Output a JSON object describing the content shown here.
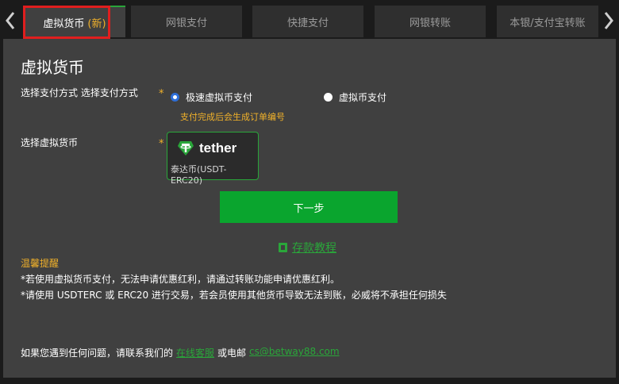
{
  "tabs": [
    {
      "label": "虚拟货币",
      "badge": "(新)",
      "active": true
    },
    {
      "label": "网银支付",
      "active": false
    },
    {
      "label": "快捷支付",
      "active": false
    },
    {
      "label": "网银转账",
      "active": false
    },
    {
      "label": "本银/支付宝转账",
      "active": false
    }
  ],
  "panel": {
    "title": "虚拟货币",
    "payment_method": {
      "label": "选择支付方式 选择支付方式",
      "required_mark": "*",
      "options": [
        {
          "label": "极速虚拟币支付",
          "selected": true
        },
        {
          "label": "虚拟币支付",
          "selected": false
        }
      ],
      "hint": "支付完成后会生成订单编号"
    },
    "currency": {
      "label": "选择虚拟货币",
      "required_mark": "*",
      "card": {
        "brand": "tether",
        "subtitle": "泰达币(USDT-ERC20)"
      }
    },
    "next_button": "下一步",
    "tutorial_link": "存款教程",
    "tips": {
      "title": "温馨提醒",
      "lines": [
        "*若使用虚拟货币支付，无法申请优惠红利，请通过转账功能申请优惠红利。",
        "*请使用 USDTERC 或 ERC20 进行交易，若会员使用其他货币导致无法到账，必威将不承担任何损失"
      ]
    },
    "contact": {
      "prefix": "如果您遇到任何问题，请联系我们的",
      "live_chat": "在线客服",
      "middle": "或电邮",
      "email": "cs@betway88.com"
    }
  },
  "colors": {
    "accent_green": "#2aa63a",
    "button_green": "#0aa52e",
    "warning_yellow": "#f0b12a",
    "highlight_red": "#e01e1e",
    "radio_blue": "#2f6fd8"
  },
  "icons": {
    "prev": "chevron-left-icon",
    "next": "chevron-right-icon",
    "tether": "tether-logo-icon",
    "tutorial": "document-icon"
  }
}
